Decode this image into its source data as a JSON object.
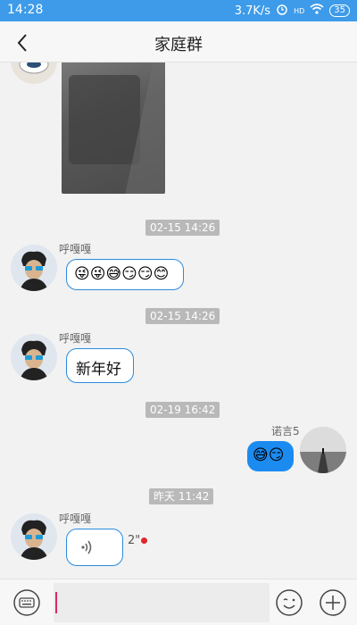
{
  "status_bar": {
    "time": "14:28",
    "speed": "3.7K/s",
    "battery": "35"
  },
  "nav": {
    "title": "家庭群"
  },
  "messages": [
    {
      "type": "time",
      "text": "02-15 14:26"
    },
    {
      "type": "incoming",
      "sender": "呼嘎嘎",
      "content": "😜😜😅😏😏😊"
    },
    {
      "type": "time",
      "text": "02-15 14:26"
    },
    {
      "type": "incoming",
      "sender": "呼嘎嘎",
      "content": "新年好"
    },
    {
      "type": "time",
      "text": "02-19 16:42"
    },
    {
      "type": "outgoing",
      "sender": "诺言5",
      "content": "😅😏"
    },
    {
      "type": "time",
      "text": "昨天 11:42"
    },
    {
      "type": "incoming-voice",
      "sender": "呼嘎嘎",
      "duration": "2\""
    }
  ],
  "colors": {
    "accent": "#3d9be9",
    "bubble_border": "#2a8cdf",
    "outgoing_bubble": "#1c8bf0",
    "unread_dot": "#e0252b"
  },
  "icons": [
    "back-icon",
    "keyboard-icon",
    "emoji-icon",
    "add-icon",
    "voice-icon",
    "wifi-icon",
    "alarm-icon"
  ]
}
